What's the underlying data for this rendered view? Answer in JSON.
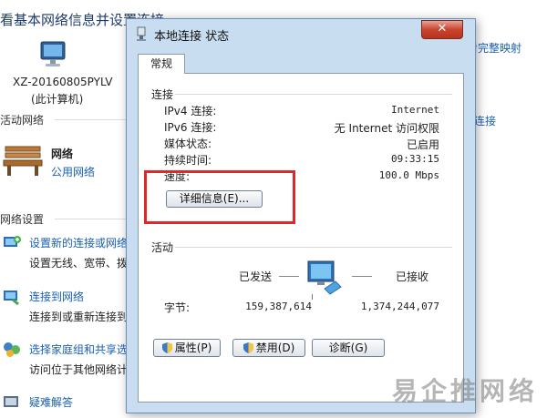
{
  "background": {
    "title": "看基本网络信息并设置连接",
    "computer_name": "XZ-20160805PYLV",
    "computer_sub": "(此计算机)",
    "right_link_mapping": "查看完整映射",
    "active_network_header": "活动网络",
    "network_name": "网络",
    "network_type": "公用网络",
    "right_link_connection": "断开连接",
    "change_settings_header": "网络设置",
    "items": [
      {
        "link": "设置新的连接或网络",
        "desc": "设置无线、宽带、拨"
      },
      {
        "link": "连接到网络",
        "desc": "连接到或重新连接到"
      },
      {
        "link": "选择家庭组和共享选",
        "desc": "访问位于其他网络计"
      },
      {
        "link": "疑难解答",
        "desc": ""
      }
    ]
  },
  "dialog": {
    "title": "本地连接 状态",
    "close_label": "✕",
    "tab_general": "常规",
    "connection_group": "连接",
    "rows": [
      {
        "label": "IPv4 连接:",
        "value": "Internet"
      },
      {
        "label": "IPv6 连接:",
        "value": "无 Internet 访问权限"
      },
      {
        "label": "媒体状态:",
        "value": "已启用"
      },
      {
        "label": "持续时间:",
        "value": "09:33:15"
      },
      {
        "label": "速度:",
        "value": "100.0 Mbps"
      }
    ],
    "details_button": "详细信息(E)...",
    "activity_group": "活动",
    "sent_label": "已发送",
    "received_label": "已接收",
    "bytes_label": "字节:",
    "bytes_sent": "159,387,614",
    "bytes_received": "1,374,244,077",
    "properties_button": "属性(P)",
    "disable_button": "禁用(D)",
    "diagnose_button": "诊断(G)"
  },
  "watermark": "易企推网络",
  "colors": {
    "link": "#1a5fb4",
    "dialog_frame": "#c9ddf0",
    "highlight": "#e0282a"
  }
}
